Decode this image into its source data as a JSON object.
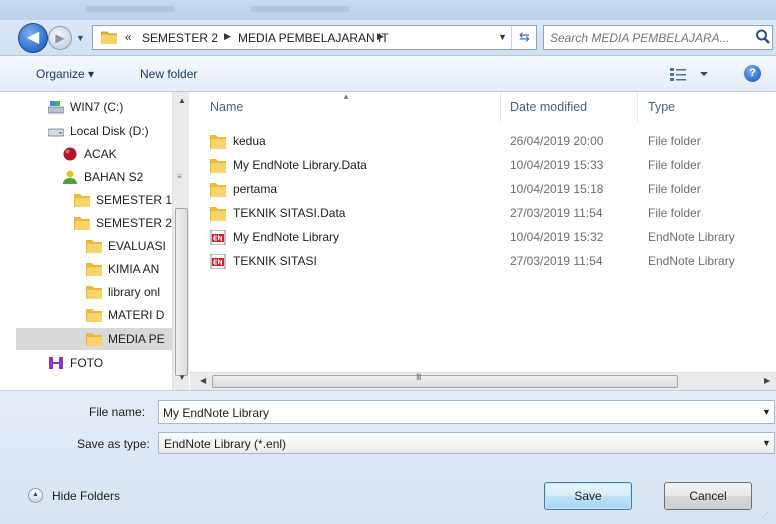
{
  "address_bar": {
    "crumbs": [
      "SEMESTER 2",
      "MEDIA PEMBELAJARAN IT"
    ],
    "overflow_chevron": "«",
    "search_placeholder": "Search MEDIA PEMBELAJARA..."
  },
  "toolbar": {
    "organize_label": "Organize ▾",
    "new_folder_label": "New folder"
  },
  "nav_pane": {
    "items": [
      {
        "label": "WIN7 (C:)",
        "icon": "drive-icon"
      },
      {
        "label": "Local Disk (D:)",
        "icon": "drive-icon"
      },
      {
        "label": "ACAK",
        "icon": "red-ball-icon"
      },
      {
        "label": "BAHAN S2",
        "icon": "yellow-user-icon"
      },
      {
        "label": "SEMESTER 1",
        "icon": "folder-icon"
      },
      {
        "label": "SEMESTER 2",
        "icon": "folder-icon"
      },
      {
        "label": "EVALUASI",
        "icon": "folder-icon"
      },
      {
        "label": "KIMIA AN",
        "icon": "folder-icon"
      },
      {
        "label": "library onl",
        "icon": "folder-icon"
      },
      {
        "label": "MATERI D",
        "icon": "folder-icon"
      },
      {
        "label": "MEDIA PE",
        "icon": "folder-icon",
        "selected": true
      },
      {
        "label": "FOTO",
        "icon": "foto-icon"
      }
    ]
  },
  "file_list": {
    "columns": [
      "Name",
      "Date modified",
      "Type"
    ],
    "rows": [
      {
        "name": "kedua",
        "date": "26/04/2019 20:00",
        "type": "File folder",
        "icon": "folder-icon"
      },
      {
        "name": "My EndNote Library.Data",
        "date": "10/04/2019 15:33",
        "type": "File folder",
        "icon": "folder-icon"
      },
      {
        "name": "pertama",
        "date": "10/04/2019 15:18",
        "type": "File folder",
        "icon": "folder-icon"
      },
      {
        "name": "TEKNIK SITASI.Data",
        "date": "27/03/2019 11:54",
        "type": "File folder",
        "icon": "folder-icon"
      },
      {
        "name": "My EndNote Library",
        "date": "10/04/2019 15:32",
        "type": "EndNote Library",
        "icon": "endnote-icon"
      },
      {
        "name": "TEKNIK SITASI",
        "date": "27/03/2019 11:54",
        "type": "EndNote Library",
        "icon": "endnote-icon"
      }
    ]
  },
  "form": {
    "file_name_label": "File name:",
    "file_name_value": "My EndNote Library",
    "save_as_type_label": "Save as type:",
    "save_as_type_value": "EndNote Library (*.enl)"
  },
  "footer": {
    "hide_folders_label": "Hide Folders",
    "save_label": "Save",
    "cancel_label": "Cancel"
  },
  "colors": {
    "folder": "#e8b93a",
    "accent_blue": "#2d6cc8",
    "selected_row": "#d9d9d9"
  }
}
